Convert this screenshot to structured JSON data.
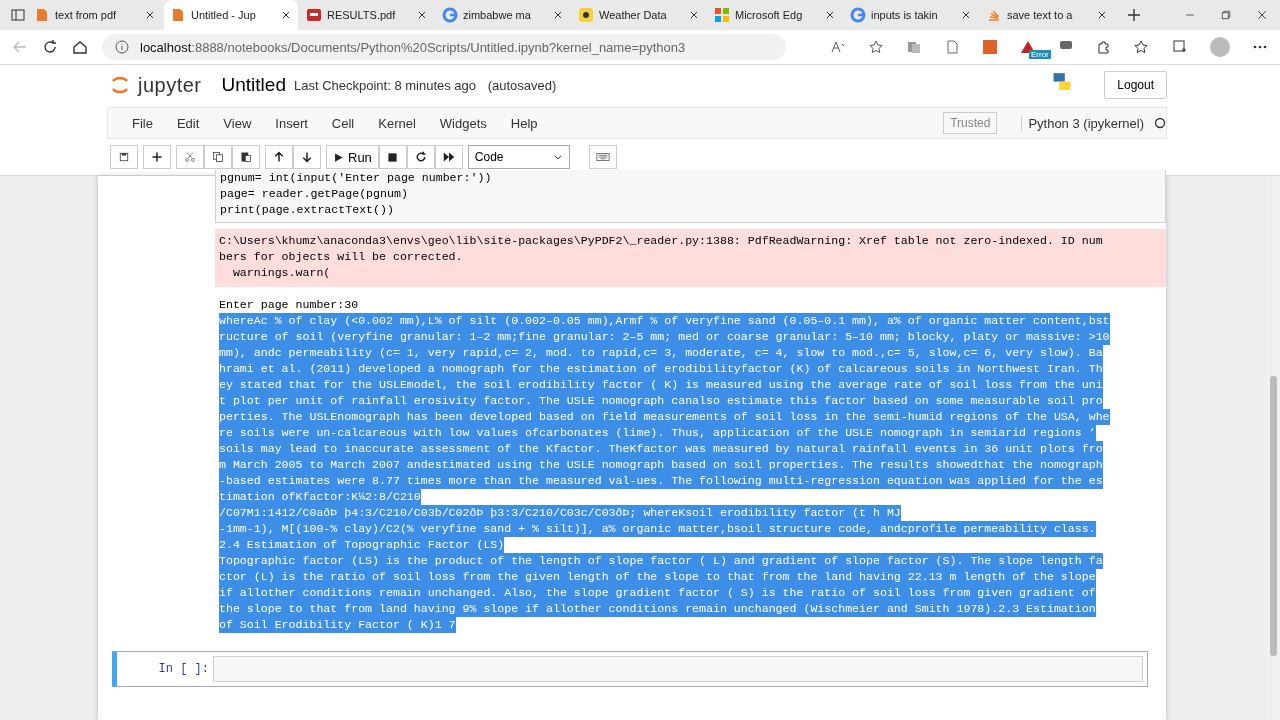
{
  "browser": {
    "tabs": [
      {
        "title": "text from pdf",
        "kind": "doc",
        "selected": false
      },
      {
        "title": "Untitled - Jup",
        "kind": "doc",
        "selected": true
      },
      {
        "title": "RESULTS.pdf",
        "kind": "pdf",
        "selected": false
      },
      {
        "title": "zimbabwe ma",
        "kind": "g",
        "selected": false
      },
      {
        "title": "Weather Data",
        "kind": "weather",
        "selected": false
      },
      {
        "title": "Microsoft Edg",
        "kind": "ms",
        "selected": false
      },
      {
        "title": "inputs is takin",
        "kind": "g",
        "selected": false
      },
      {
        "title": "save text to a",
        "kind": "stack",
        "selected": false
      }
    ],
    "url_host": "localhost",
    "url_rest": ":8888/notebooks/Documents/Python%20Scripts/Untitled.ipynb?kernel_name=python3",
    "ext_badge": "Error"
  },
  "header": {
    "logo": "jupyter",
    "title": "Untitled",
    "checkpoint": "Last Checkpoint: 8 minutes ago",
    "saved": "(autosaved)",
    "logout": "Logout"
  },
  "menu": {
    "items": [
      "File",
      "Edit",
      "View",
      "Insert",
      "Cell",
      "Kernel",
      "Widgets",
      "Help"
    ],
    "trusted": "Trusted",
    "kernel": "Python 3 (ipykernel)"
  },
  "toolbar": {
    "run": "Run",
    "cell_type": "Code"
  },
  "code_lines": [
    "pgnum= int(input('Enter page number:'))",
    "page= reader.getPage(pgnum)",
    "print(page.extractText())"
  ],
  "stderr_lines": [
    "C:\\Users\\khumz\\anaconda3\\envs\\geo\\lib\\site-packages\\PyPDF2\\_reader.py:1388: PdfReadWarning: Xref table not zero-indexed. ID num",
    "bers for objects will be corrected.",
    "  warnings.warn("
  ],
  "stdout_prompt": "Enter page number:30",
  "output": {
    "selected": true,
    "lines": [
      "whereAc % of clay (<0.002 mm),L% of silt (0.002–0.05 mm),Armf % of veryfine sand (0.05–0.1 mm), a% of organic matter content,bst",
      "ructure of soil (veryfine granular: 1–2 mm;fine granular: 2–5 mm; med or coarse granular: 5–10 mm; blocky, platy or massive: >10",
      "mm), andc permeability (c= 1, very rapid,c= 2, mod. to rapid,c= 3, moderate, c= 4, slow to mod.,c= 5, slow,c= 6, very slow). Ba",
      "hrami et al. (2011) developed a nomograph for the estimation of erodibilityfactor (K) of calcareous soils in Northwest Iran. Th",
      "ey stated that for the USLEmodel, the soil erodibility factor ( K) is measured using the average rate of soil loss from the uni",
      "t plot per unit of rainfall erosivity factor. The USLE nomograph canalso estimate this factor based on some measurable soil pro",
      "perties. The USLEnomograph has been developed based on field measurements of soil loss in the semi-humid regions of the USA, whe",
      "re soils were un-calcareous with low values ofcarbonates (lime). Thus, application of the USLE nomograph in semiarid regions ’",
      "soils may lead to inaccurate assessment of the Kfactor. TheKfactor was measured by natural rainfall events in 36 unit plots fro",
      "m March 2005 to March 2007 andestimated using the USLE nomograph based on soil properties. The results showedthat the nomograph",
      "-based estimates were 8.77 times more than the measured val-ues. The following multi-regression equation was applied for the es",
      "timation ofKfactor:K¼2:8/C210",
      "/C07M1:1412/C0aðÞ þ4:3/C210/C03b/C02ðÞ þ3:3/C210/C03c/C03ðÞ; whereKsoil erodibility factor (t h MJ",
      "-1mm-1), M[(100-% clay)/C2(% veryfine sand + % silt)], a% organic matter,bsoil structure code, andcprofile permeability class.",
      "2.4 Estimation of Topographic Factor (LS)",
      "Topographic factor (LS) is the product of the length of slope factor ( L) and gradient of slope factor (S). The slope length fa",
      "ctor (L) is the ratio of soil loss from the given length of the slope to that from the land having 22.13 m length of the slope",
      "if allother conditions remain unchanged. Also, the slope gradient factor ( S) is the ratio of soil loss from given gradient of",
      "the slope to that from land having 9% slope if allother conditions remain unchanged (Wischmeier and Smith 1978).2.3 Estimation",
      "of Soil Erodibility Factor ( K)1 7"
    ]
  },
  "next_cell": {
    "prompt": "In [ ]:"
  }
}
